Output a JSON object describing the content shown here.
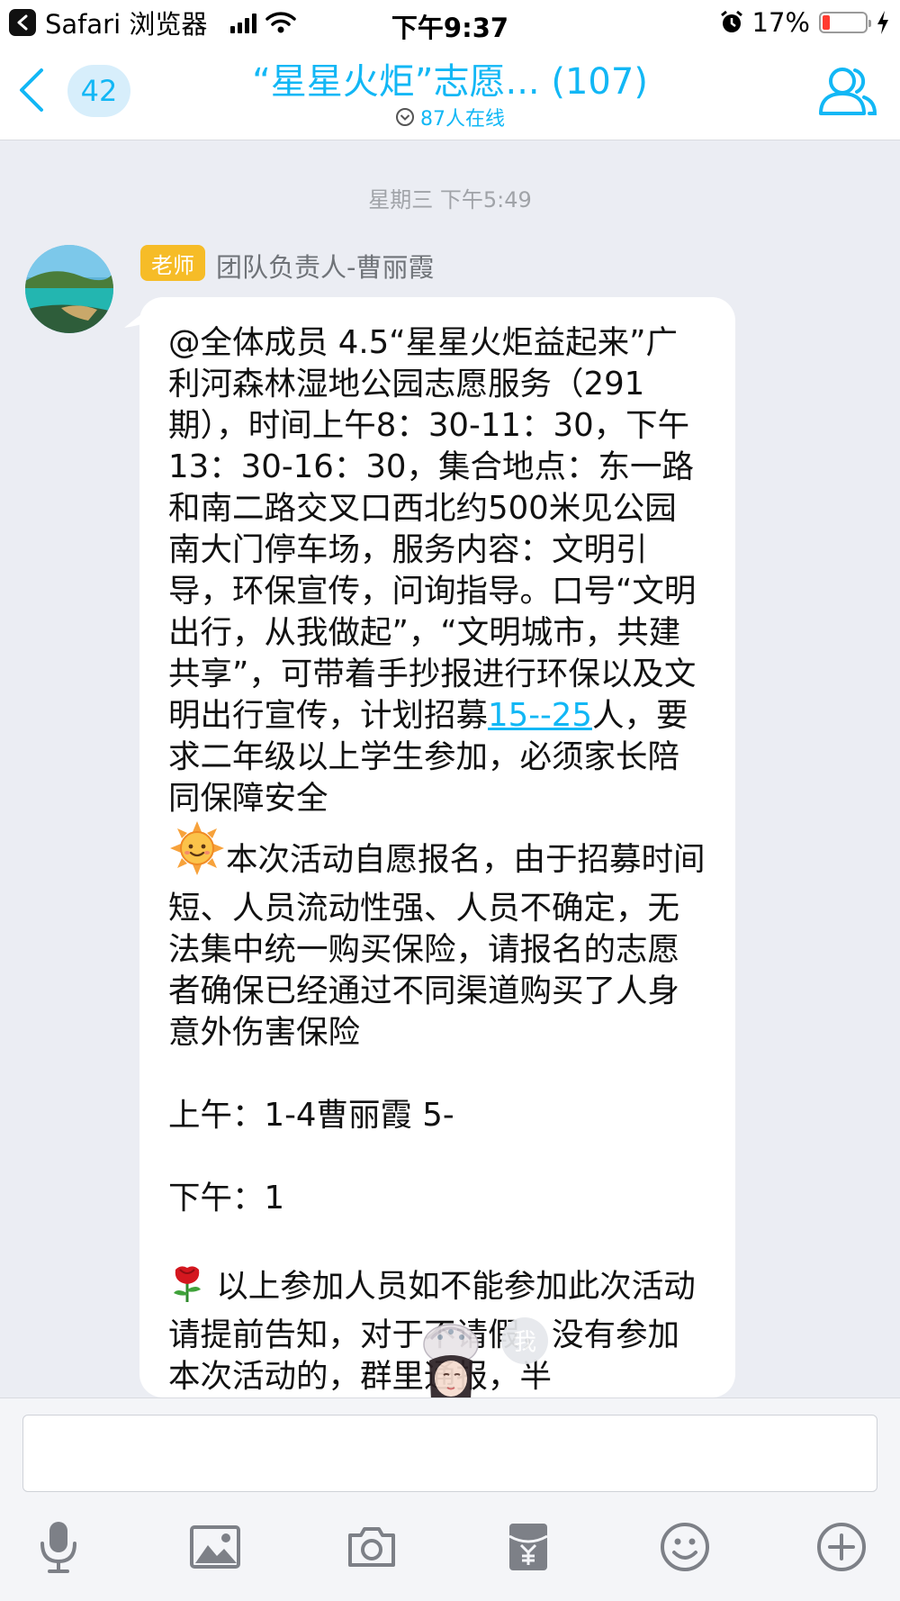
{
  "status_bar": {
    "app_label": "Safari 浏览器",
    "time": "下午9:37",
    "battery": "17%",
    "battery_level": 0.17
  },
  "nav": {
    "unread_count": "42",
    "title": "“星星火炬”志愿... (107)",
    "online": "87人在线"
  },
  "chat": {
    "timestamp": "星期三 下午5:49",
    "message": {
      "role_badge": "老师",
      "sender": "团队负责人-曹丽霞",
      "part1": "@全体成员 4.5“星星火炬益起来”广利河森林湿地公园志愿服务（291期），时间上午8：30-11：30，下午13：30-16：30，集合地点：东一路和南二路交叉口西北约500米见公园南大门停车场，服务内容：文明引导，环保宣传，问询指导。口号“文明出行，从我做起”，“文明城市，共建共享”，可带着手抄报进行环保以及文明出行宣传，计划招募",
      "link": "15--25",
      "part2": "人，要求二年级以上学生参加，必须家长陪同保障安全\n",
      "part3": "本次活动自愿报名，由于招募时间短、人员流动性强、人员不确定，无法集中统一购买保险，请报名的志愿者确保已经通过不同渠道购买了人身意外伤害保险\n\n上午：1-4曹丽霞 5-\n\n下午：1\n\n",
      "part4": " 以上参加人员如不能参加此次活动请提前告知，对于不请假，没有参加本次活动的，群里通报，半"
    },
    "sticker_text": "我"
  },
  "input": {
    "placeholder": ""
  },
  "toolbar": [
    "microphone-icon",
    "image-icon",
    "camera-icon",
    "red-packet-icon",
    "emoji-icon",
    "plus-icon"
  ],
  "colors": {
    "accent": "#12b7f5",
    "badge": "#f6bc27",
    "background": "#ebedf3",
    "battery_low": "#ff3b30"
  }
}
